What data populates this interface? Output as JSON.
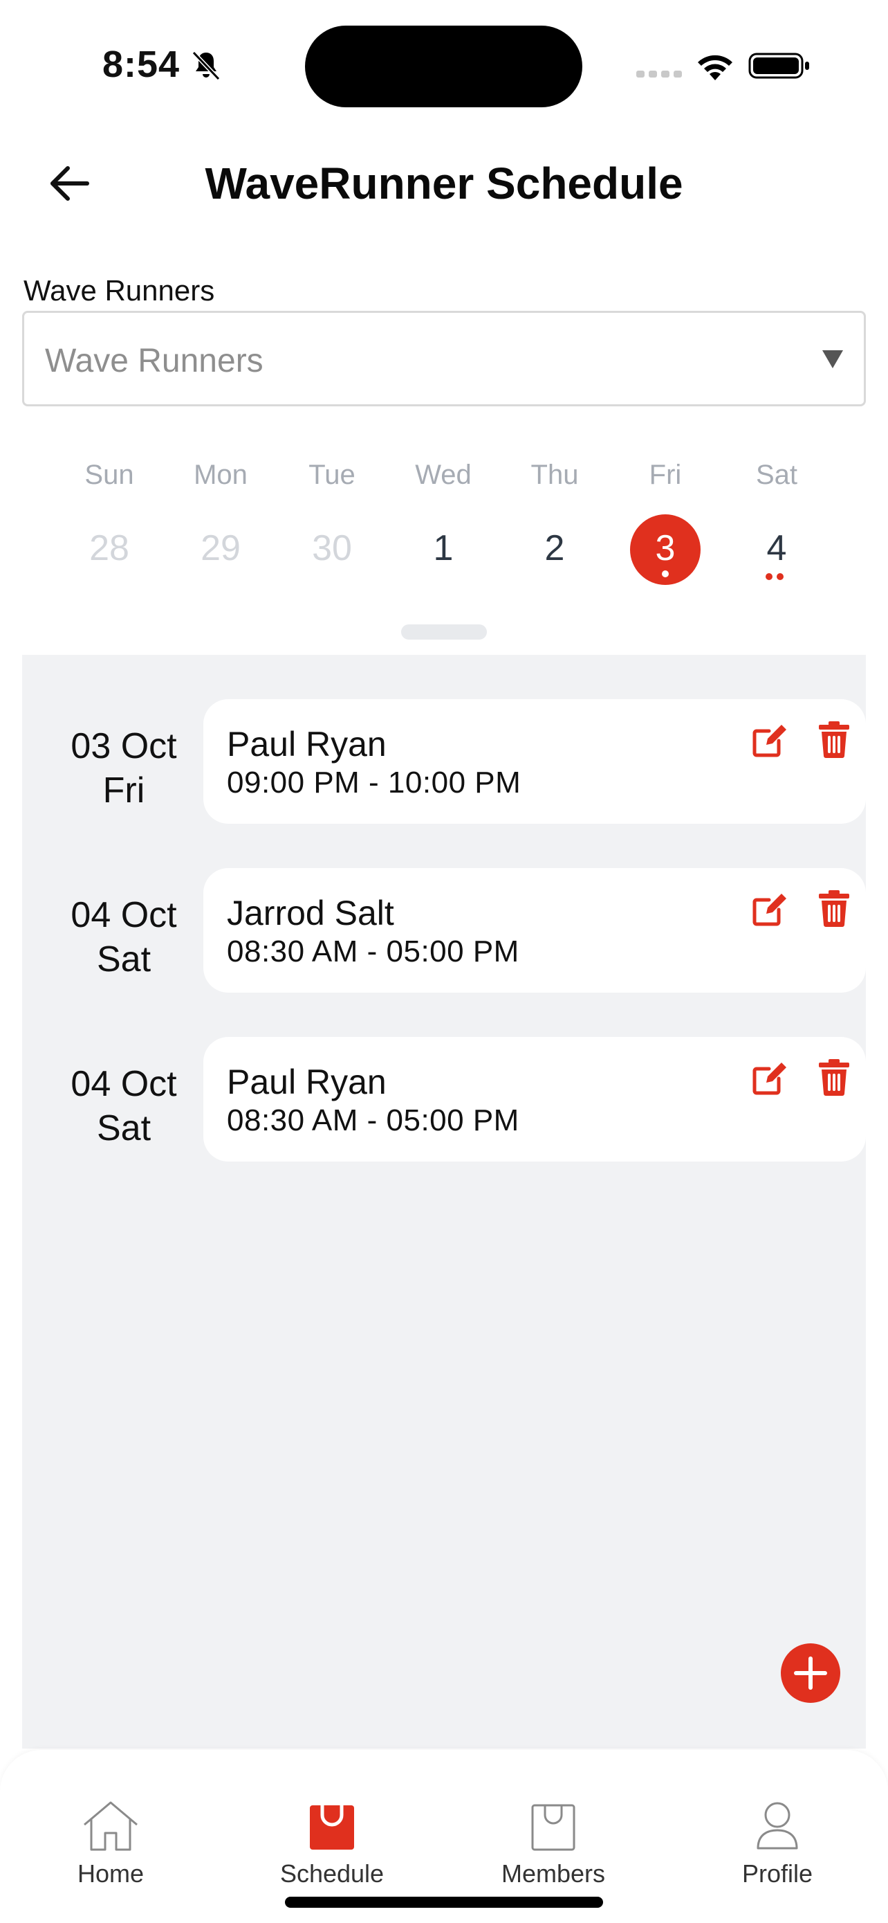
{
  "status_bar": {
    "time": "8:54"
  },
  "header": {
    "title": "WaveRunner Schedule"
  },
  "filter": {
    "label": "Wave Runners",
    "placeholder": "Wave Runners"
  },
  "calendar": {
    "weekdays": [
      "Sun",
      "Mon",
      "Tue",
      "Wed",
      "Thu",
      "Fri",
      "Sat"
    ],
    "dates": [
      "28",
      "29",
      "30",
      "1",
      "2",
      "3",
      "4"
    ],
    "selected_index": 5
  },
  "schedule": [
    {
      "date": "03 Oct",
      "day": "Fri",
      "name": "Paul Ryan",
      "time": "09:00 PM - 10:00 PM"
    },
    {
      "date": "04 Oct",
      "day": "Sat",
      "name": "Jarrod Salt",
      "time": "08:30 AM - 05:00 PM"
    },
    {
      "date": "04 Oct",
      "day": "Sat",
      "name": "Paul Ryan",
      "time": "08:30 AM - 05:00 PM"
    }
  ],
  "tabs": [
    {
      "label": "Home",
      "icon": "home-icon"
    },
    {
      "label": "Schedule",
      "icon": "shopping-bag-icon",
      "active": true
    },
    {
      "label": "Members",
      "icon": "bag-icon"
    },
    {
      "label": "Profile",
      "icon": "person-icon"
    }
  ],
  "colors": {
    "accent": "#e0301e",
    "panel": "#f1f2f4"
  }
}
